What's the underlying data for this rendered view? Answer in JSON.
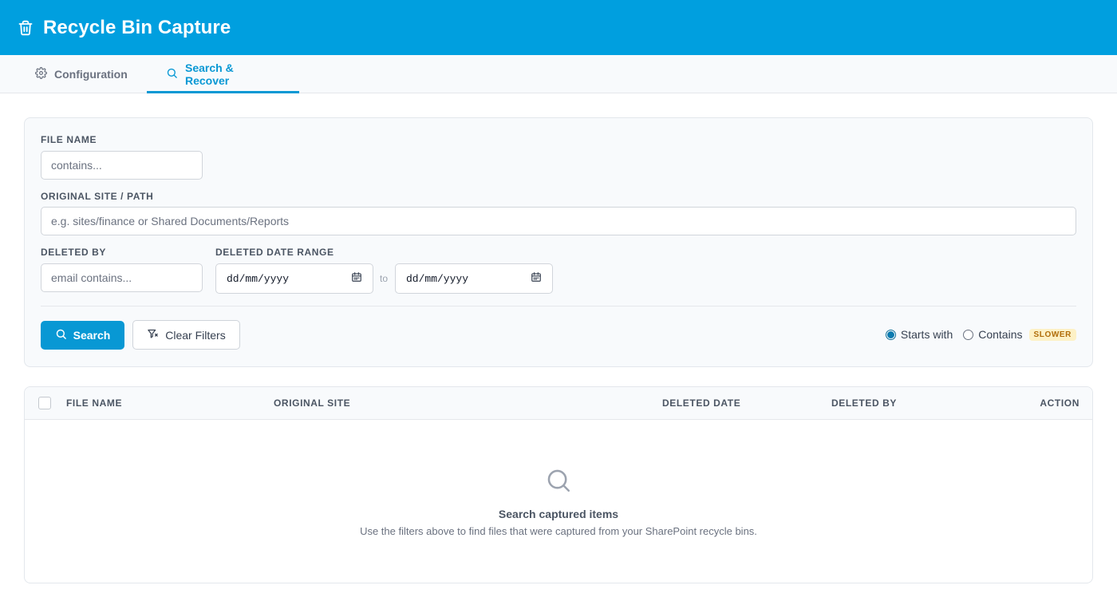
{
  "app": {
    "title": "Recycle Bin Capture"
  },
  "tabs": [
    {
      "label": "Configuration",
      "icon": "gear-icon"
    },
    {
      "label": "Search & Recover",
      "icon": "search-icon",
      "active": true
    }
  ],
  "filters": {
    "file_name": {
      "label": "File name",
      "placeholder": "contains..."
    },
    "original_site": {
      "label": "Original site / path",
      "placeholder": "e.g. sites/finance or Shared Documents/Reports"
    },
    "deleted_by": {
      "label": "Deleted by",
      "placeholder": "email contains..."
    },
    "date_range": {
      "label": "Deleted date range",
      "from": "dd/mm/yyyy",
      "separator": "to",
      "to": "dd/mm/yyyy"
    },
    "search_button": "Search",
    "clear_button": "Clear Filters",
    "match_mode": {
      "options": [
        "Starts with",
        "Contains"
      ],
      "selected": "Starts with",
      "contains_badge": "SLOWER"
    }
  },
  "table": {
    "columns": [
      "File name",
      "Original site",
      "Deleted date",
      "Deleted by",
      "Action"
    ],
    "empty_title": "Search captured items",
    "empty_subtitle": "Use the filters above to find files that were captured from your SharePoint recycle bins."
  },
  "colors": {
    "brand": "#009fdf",
    "accent": "#0898d4",
    "badge_bg": "#fdf1c6",
    "badge_text": "#b06d09"
  }
}
